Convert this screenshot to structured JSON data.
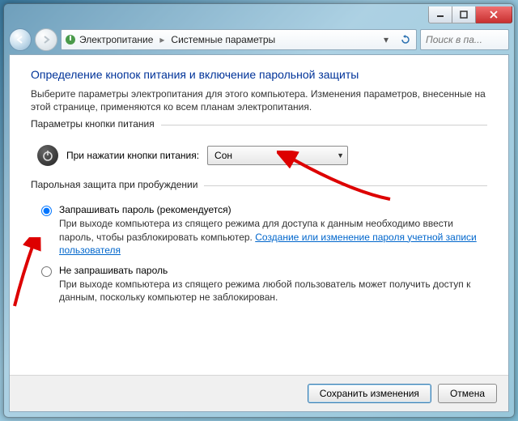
{
  "titlebar": {
    "title": ""
  },
  "nav": {
    "crumb_root": "Электропитание",
    "crumb_leaf": "Системные параметры",
    "search_placeholder": "Поиск в па..."
  },
  "page": {
    "heading": "Определение кнопок питания и включение парольной защиты",
    "intro": "Выберите параметры электропитания для этого компьютера. Изменения параметров, внесенные на этой странице, применяются ко всем планам электропитания."
  },
  "group_power": {
    "legend": "Параметры кнопки питания",
    "label": "При нажатии кнопки питания:",
    "selected": "Сон"
  },
  "group_pass": {
    "legend": "Парольная защита при пробуждении",
    "opt1_title": "Запрашивать пароль (рекомендуется)",
    "opt1_desc_a": "При выходе компьютера из спящего режима для доступа к данным необходимо ввести пароль, чтобы разблокировать компьютер. ",
    "opt1_link": "Создание или изменение пароля учетной записи пользователя",
    "opt2_title": "Не запрашивать пароль",
    "opt2_desc": "При выходе компьютера из спящего режима любой пользователь может получить доступ к данным, поскольку компьютер не заблокирован."
  },
  "footer": {
    "save": "Сохранить изменения",
    "cancel": "Отмена"
  }
}
